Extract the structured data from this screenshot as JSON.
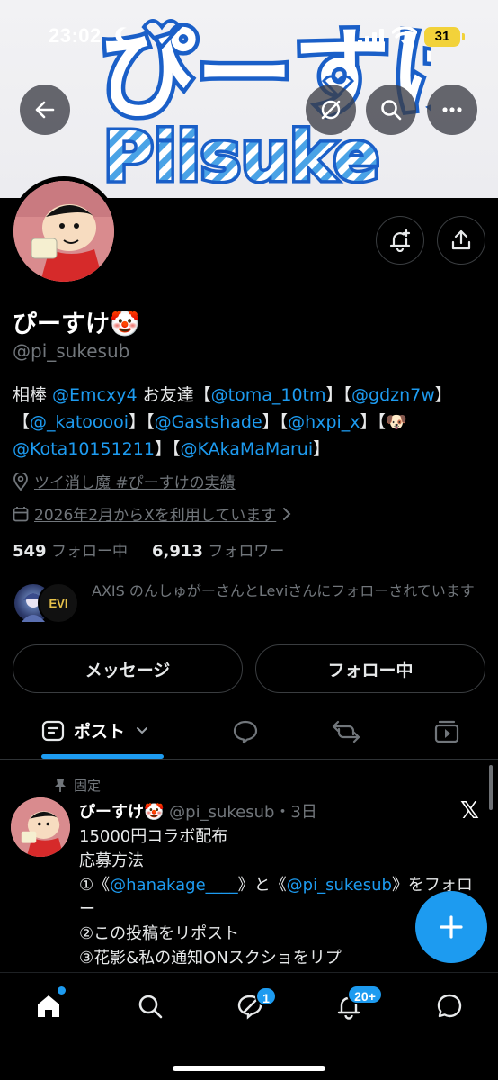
{
  "status_bar": {
    "time": "23:02",
    "battery": "31"
  },
  "banner": {
    "title_text": "ぴーすけ",
    "subtitle_text": "Piisuke"
  },
  "header_buttons": {
    "back": "back",
    "search": "search",
    "more": "more"
  },
  "profile": {
    "name": "ぴーすけ🤡",
    "handle": "@pi_sukesub",
    "bio": {
      "prefix": "相棒 ",
      "partner": "@Emcxy4",
      "friends_label": " お友達【",
      "friend1": "@toma_10tm",
      "sep1": "】【",
      "friend2": "@gdzn7w",
      "sep2": "】",
      "open3": "【",
      "friend3": "@_katooooi",
      "sep3": "】【",
      "friend4": "@Gastshade",
      "sep4": "】【",
      "friend5": "@hxpi_x",
      "sep5": "】【🐶",
      "friend6": "@Kota10151211",
      "sep6": "】【",
      "friend7": "@KAkaMaMarui",
      "close": "】"
    },
    "location": "ツイ消し魔 #ぴーすけの実績",
    "joined": "2026年2月からXを利用しています",
    "following_count": "549",
    "following_label": "フォロー中",
    "followers_count": "6,913",
    "followers_label": "フォロワー",
    "followed_by": "AXIS のんしゅがーさんとLeviさんにフォローされています",
    "follower_badge_text": "EVI"
  },
  "actions": {
    "message": "メッセージ",
    "following": "フォロー中"
  },
  "tabs": [
    {
      "label": "ポスト",
      "icon": "post-icon"
    },
    {
      "label": "",
      "icon": "reply-icon"
    },
    {
      "label": "",
      "icon": "repost-icon"
    },
    {
      "label": "",
      "icon": "media-icon"
    }
  ],
  "pinned_post": {
    "pinned_label": "固定",
    "author": "ぴーすけ🤡",
    "handle": "@pi_sukesub",
    "time": "・3日",
    "line1": "15000円コラボ配布",
    "line2": "応募方法",
    "line3_a": "①《",
    "line3_link1": "@hanakage____",
    "line3_b": "》と《",
    "line3_link2": "@pi_sukesub",
    "line3_c": "》をフォロー",
    "line4": "②この投稿をリポスト",
    "line5": "③花影&私の通知ONスクショをリプ"
  },
  "bottom_nav": {
    "messages_badge": "1",
    "notifications_badge": "20+"
  },
  "colors": {
    "accent": "#1d9bf0",
    "background": "#000000",
    "muted": "#71767b"
  }
}
